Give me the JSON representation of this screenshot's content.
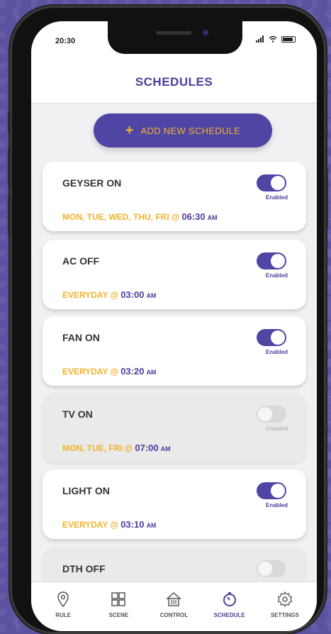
{
  "status": {
    "time": "20:30"
  },
  "header": {
    "title": "SCHEDULES"
  },
  "add_button": {
    "icon": "plus-icon",
    "label": "ADD NEW SCHEDULE"
  },
  "schedules": [
    {
      "name": "GEYSER ON",
      "enabled": true,
      "state_label": "Enabled",
      "days": "MON, TUE, WED, THU, FRI",
      "at": "@",
      "time": "06:30",
      "ampm": "AM"
    },
    {
      "name": "AC OFF",
      "enabled": true,
      "state_label": "Enabled",
      "days": "EVERYDAY",
      "at": "@",
      "time": "03:00",
      "ampm": "AM"
    },
    {
      "name": "FAN ON",
      "enabled": true,
      "state_label": "Enabled",
      "days": "EVERYDAY",
      "at": "@",
      "time": "03:20",
      "ampm": "AM"
    },
    {
      "name": "TV ON",
      "enabled": false,
      "state_label": "Disabled",
      "days": "MON, TUE, FRI",
      "at": "@",
      "time": "07:00",
      "ampm": "AM"
    },
    {
      "name": "LIGHT ON",
      "enabled": true,
      "state_label": "Enabled",
      "days": "EVERYDAY",
      "at": "@",
      "time": "03:10",
      "ampm": "AM"
    },
    {
      "name": "DTH OFF",
      "enabled": false,
      "state_label": "",
      "days": "",
      "at": "",
      "time": "",
      "ampm": ""
    }
  ],
  "tabs": [
    {
      "label": "RULE",
      "icon": "location-pin-icon",
      "active": false
    },
    {
      "label": "SCENE",
      "icon": "scene-grid-icon",
      "active": false
    },
    {
      "label": "CONTROL",
      "icon": "home-control-icon",
      "active": false
    },
    {
      "label": "SCHEDULE",
      "icon": "timer-icon",
      "active": true
    },
    {
      "label": "SETTINGS",
      "icon": "gear-icon",
      "active": false
    }
  ],
  "colors": {
    "accent": "#4e45a5",
    "highlight": "#f2b12a",
    "background": "#5b52a0"
  }
}
